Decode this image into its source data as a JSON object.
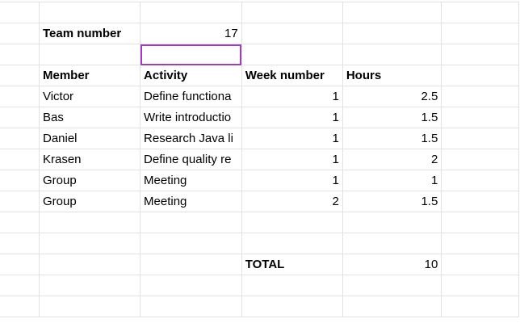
{
  "team_label": "Team number",
  "team_number": "17",
  "headers": [
    "Member",
    "Activity",
    "Week number",
    "Hours"
  ],
  "rows": [
    [
      "Victor",
      "Define functiona",
      "1",
      "2.5"
    ],
    [
      "Bas",
      "Write introductio",
      "1",
      "1.5"
    ],
    [
      "Daniel",
      "Research Java li",
      "1",
      "1.5"
    ],
    [
      "Krasen",
      "Define quality re",
      "1",
      "2"
    ],
    [
      "Group",
      "Meeting",
      "1",
      "1"
    ],
    [
      "Group",
      "Meeting",
      "2",
      "1.5"
    ]
  ],
  "total_label": "TOTAL",
  "total_value": "10",
  "selection_color": "#9c3fb5"
}
